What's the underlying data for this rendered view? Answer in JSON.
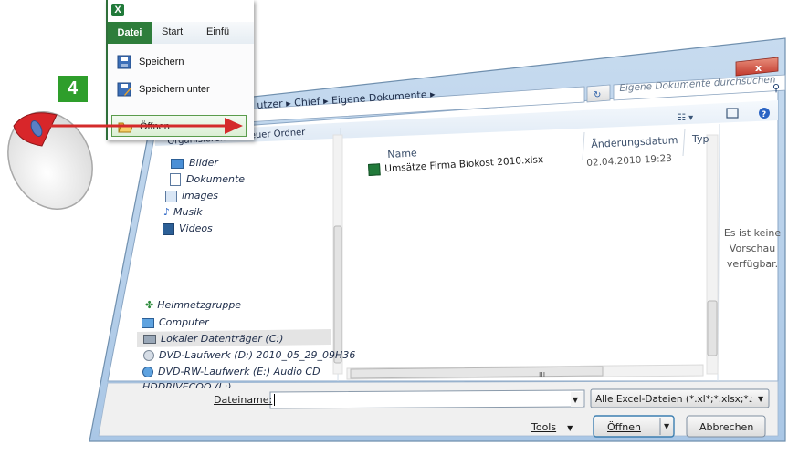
{
  "step": {
    "number": "4"
  },
  "excel": {
    "app_icon": "X",
    "tabs": {
      "file": "Datei",
      "start": "Start",
      "insert": "Einfü"
    },
    "menu": [
      {
        "label": "Speichern",
        "icon": "save-icon"
      },
      {
        "label": "Speichern unter",
        "icon": "save-as-icon"
      },
      {
        "label": "Öffnen",
        "icon": "open-folder-icon",
        "active": true
      }
    ]
  },
  "dialog": {
    "breadcrumb": [
      "utzer",
      "Chief",
      "Eigene Dokumente"
    ],
    "search_placeholder": "Eigene Dokumente durchsuchen",
    "toolbar": {
      "organize": "Organisieren",
      "new_folder": "Neuer Ordner"
    },
    "nav": [
      {
        "label": "Bilder",
        "icon": "pictures-icon"
      },
      {
        "label": "Dokumente",
        "icon": "documents-icon"
      },
      {
        "label": "images",
        "icon": "library-icon"
      },
      {
        "label": "Musik",
        "icon": "music-icon"
      },
      {
        "label": "Videos",
        "icon": "videos-icon"
      },
      {
        "label": "Heimnetzgruppe",
        "icon": "homegroup-icon"
      },
      {
        "label": "Computer",
        "icon": "computer-icon"
      },
      {
        "label": "Lokaler Datenträger (C:)",
        "icon": "drive-icon",
        "selected": true
      },
      {
        "label": "DVD-Laufwerk (D:) 2010_05_29_09H36",
        "icon": "dvd-icon"
      },
      {
        "label": "DVD-RW-Laufwerk (E:) Audio CD",
        "icon": "cd-icon"
      },
      {
        "label": "HDDRIVECOO (L:)",
        "icon": "usb-drive-icon"
      }
    ],
    "columns": {
      "name": "Name",
      "date": "Änderungsdatum",
      "type": "Typ"
    },
    "files": [
      {
        "name": "Umsätze Firma Biokost 2010.xlsx",
        "date": "02.04.2010 19:23"
      }
    ],
    "preview": {
      "line1": "Es ist keine",
      "line2": "Vorschau",
      "line3": "verfügbar."
    },
    "filename_label": "Dateiname:",
    "filename_value": "",
    "filter": "Alle Excel-Dateien (*.xl*;*.xlsx;*.x",
    "tools": "Tools",
    "open_button": "Öffnen",
    "cancel_button": "Abbrechen",
    "hscroll_grip": "III",
    "close_glyph": "x"
  },
  "colors": {
    "accent_green": "#2e9e2b",
    "excel_green": "#2e7d3b",
    "arrow_red": "#d42b2b",
    "window_frame": "#b9d1ea",
    "close_red": "#c9463d"
  }
}
